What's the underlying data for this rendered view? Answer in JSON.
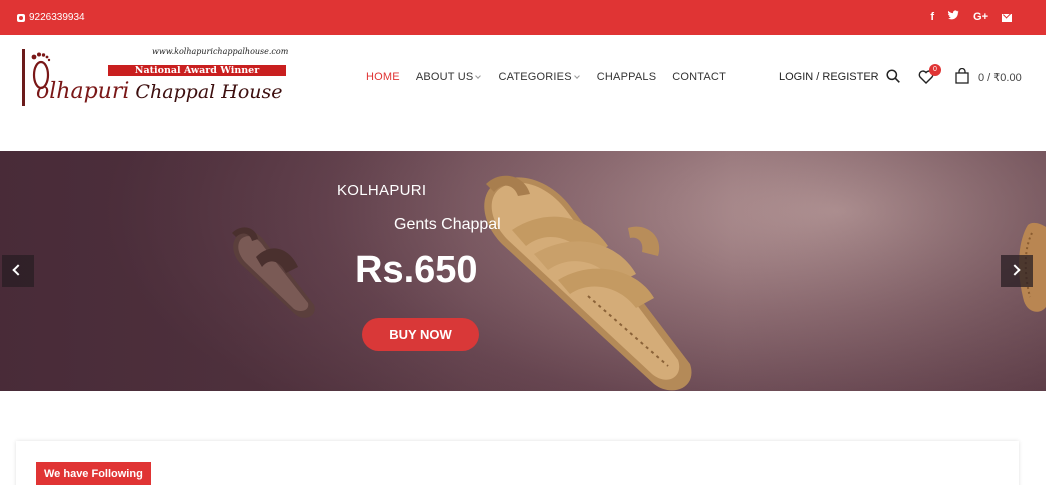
{
  "topbar": {
    "phone": "9226339934",
    "social": [
      "f",
      "t",
      "G+"
    ]
  },
  "logo": {
    "url": "www.kolhapurichappalhouse.com",
    "award": "National Award Winner",
    "brand_first": "olhapuri",
    "brand_rest": "Chappal House"
  },
  "nav": {
    "items": [
      {
        "label": "HOME",
        "active": true,
        "dropdown": false
      },
      {
        "label": "ABOUT US",
        "active": false,
        "dropdown": true
      },
      {
        "label": "CATEGORIES",
        "active": false,
        "dropdown": true
      },
      {
        "label": "CHAPPALS",
        "active": false,
        "dropdown": false
      },
      {
        "label": "CONTACT",
        "active": false,
        "dropdown": false
      }
    ]
  },
  "header_right": {
    "login": "LOGIN / REGISTER",
    "wishlist_count": "0",
    "cart": "0 / ₹0.00"
  },
  "hero": {
    "line1": "KOLHAPURI",
    "line2": "Gents Chappal",
    "price": "Rs.650",
    "cta": "BUY NOW"
  },
  "section": {
    "badge": "We have Following"
  },
  "colors": {
    "brand_red": "#e03434"
  }
}
